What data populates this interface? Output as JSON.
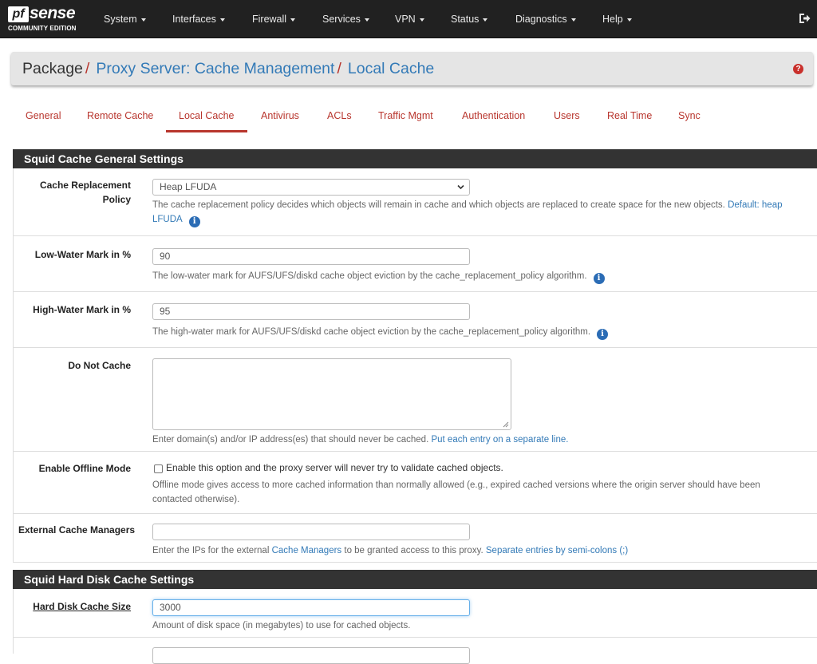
{
  "brand": {
    "logo_short": "pf",
    "logo_text": "sense",
    "edition": "COMMUNITY EDITION"
  },
  "nav": {
    "items": [
      "System",
      "Interfaces",
      "Firewall",
      "Services",
      "VPN",
      "Status",
      "Diagnostics",
      "Help"
    ]
  },
  "breadcrumb": {
    "root": "Package",
    "sep": "/",
    "level2": "Proxy Server: Cache Management",
    "level3": "Local Cache"
  },
  "tabs": [
    "General",
    "Remote Cache",
    "Local Cache",
    "Antivirus",
    "ACLs",
    "Traffic Mgmt",
    "Authentication",
    "Users",
    "Real Time",
    "Sync"
  ],
  "active_tab": "Local Cache",
  "general_section": {
    "title": "Squid Cache General Settings",
    "replacement_policy": {
      "label_line1": "Cache Replacement",
      "label_line2": "Policy",
      "value": "Heap LFUDA",
      "help": "The cache replacement policy decides which objects will remain in cache and which objects are replaced to create space for the new objects.",
      "help_default_label": "Default:",
      "help_default_value": "heap LFUDA"
    },
    "low_water": {
      "label": "Low-Water Mark in %",
      "value": "90",
      "help": "The low-water mark for AUFS/UFS/diskd cache object eviction by the cache_replacement_policy algorithm."
    },
    "high_water": {
      "label": "High-Water Mark in %",
      "value": "95",
      "help": "The high-water mark for AUFS/UFS/diskd cache object eviction by the cache_replacement_policy algorithm."
    },
    "do_not_cache": {
      "label": "Do Not Cache",
      "value": "",
      "help": "Enter domain(s) and/or IP address(es) that should never be cached.",
      "help_link": "Put each entry on a separate line."
    },
    "offline_mode": {
      "label": "Enable Offline Mode",
      "checked": false,
      "checkbox_text": "Enable this option and the proxy server will never try to validate cached objects.",
      "help_line1": "Offline mode gives access to more cached information than normally allowed (e.g., expired cached versions where the origin server should have been",
      "help_line2": "contacted otherwise)."
    },
    "ext_cache_managers": {
      "label": "External Cache Managers",
      "value": "",
      "help_pre": "Enter the IPs for the external",
      "help_link1": "Cache Managers",
      "help_mid": "to be granted access to this proxy.",
      "help_link2": "Separate entries by semi-colons (;)"
    }
  },
  "disk_section": {
    "title": "Squid Hard Disk Cache Settings",
    "disk_size": {
      "label": "Hard Disk Cache Size",
      "value": "3000",
      "help": "Amount of disk space (in megabytes) to use for cached objects."
    }
  },
  "icons": {
    "logout": "sign-out-icon",
    "help": "question-circle-icon",
    "info": "info-circle-icon",
    "info_glyph": "i",
    "help_glyph": "?"
  },
  "colors": {
    "navbar": "#212121",
    "accent_red": "#b8352d",
    "link_blue": "#337ab7",
    "panel_head": "#333333",
    "info_blue": "#2b6cb5"
  }
}
